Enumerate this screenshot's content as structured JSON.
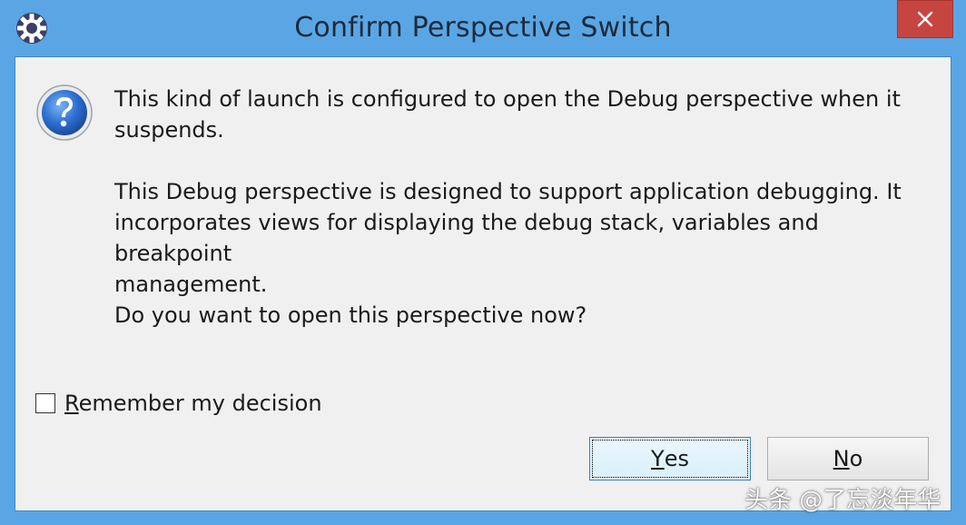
{
  "window": {
    "title": "Confirm Perspective Switch",
    "close_symbol": "✕",
    "accent_color": "#5aa6e4",
    "close_color": "#c74540"
  },
  "dialog": {
    "icon": "question-icon",
    "message_1": "This kind of launch is configured to open the Debug perspective when it\nsuspends.",
    "message_2": "This Debug perspective is designed to support application debugging.  It\nincorporates views for displaying the debug stack, variables and breakpoint\nmanagement.",
    "message_3": "Do you want to open this perspective now?",
    "remember": {
      "label_first": "R",
      "label_rest": "emember my decision",
      "checked": false
    }
  },
  "buttons": {
    "yes_first": "Y",
    "yes_rest": "es",
    "no_first": "N",
    "no_rest": "o"
  },
  "watermark": "头条 @了忘淡年华"
}
